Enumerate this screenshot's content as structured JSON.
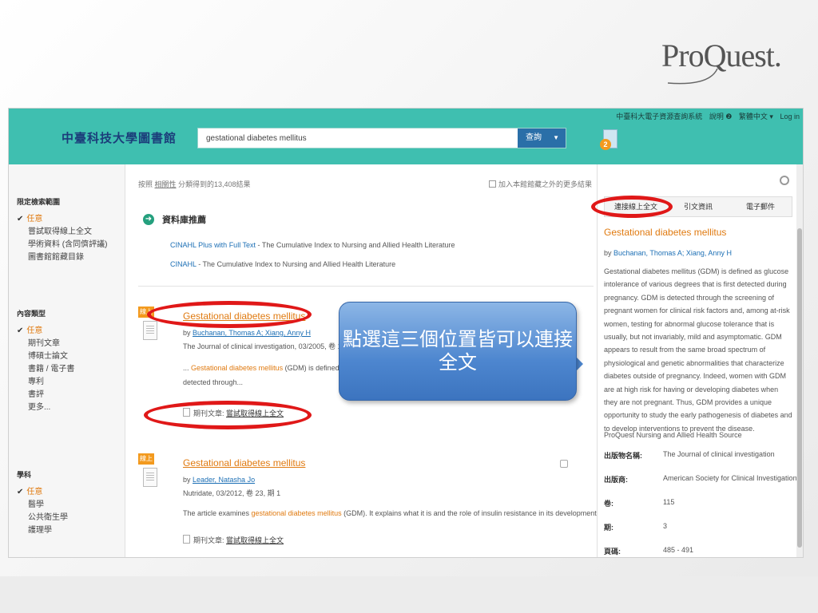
{
  "brand": {
    "logo_text": "ProQuest."
  },
  "header": {
    "top_links": [
      "中臺科大電子資源查詢系統",
      "說明 ❷",
      "繁體中文 ▾",
      "Log in"
    ],
    "library_name": "中臺科技大學圖書館",
    "search": {
      "value": "gestational diabetes mellitus",
      "button_label": "查詢"
    },
    "folder_count": "2"
  },
  "sidebar": {
    "groups": [
      {
        "title": "限定檢索範圍",
        "items": [
          "任意",
          "嘗試取得線上全文",
          "學術資料 (含同儕評議)",
          "圖書館館藏目錄"
        ]
      },
      {
        "title": "內容類型",
        "items": [
          "任意",
          "期刊文章",
          "博碩士論文",
          "書籍 / 電子書",
          "專利",
          "書評",
          "更多..."
        ]
      },
      {
        "title": "學科",
        "items": [
          "任意",
          "醫學",
          "公共衛生學",
          "護理學"
        ]
      }
    ]
  },
  "main": {
    "result_count": {
      "prefix": "按照 ",
      "link": "相關性",
      "suffix": " 分類得到的13,408結果"
    },
    "expand_label": "加入本館館藏之外的更多結果",
    "db_recommend": {
      "title": "資料庫推薦",
      "links": [
        {
          "name": "CINAHL Plus with Full Text",
          "desc": " - The Cumulative Index to Nursing and Allied Health Literature"
        },
        {
          "name": "CINAHL",
          "desc": " - The Cumulative Index to Nursing and Allied Health Literature"
        }
      ]
    },
    "records": [
      {
        "tag": "線上",
        "title": "Gestational diabetes mellitus",
        "by": "by ",
        "authors": "Buchanan, Thomas A; Xiang, Anny H",
        "pub": "The Journal of clinical investigation, 03/2005, 卷 115, 期 3",
        "snippet_pre": "... ",
        "snippet_hl": "Gestational diabetes mellitus",
        "snippet_post": " (GDM) is defined as glucose",
        "snippet_line2": "detected through...",
        "type_label": "期刊文章: ",
        "fulltext_link": "嘗試取得線上全文"
      },
      {
        "tag": "線上",
        "title": "Gestational diabetes mellitus",
        "by": "by ",
        "authors": "Leader, Natasha Jo",
        "pub": "Nutridate, 03/2012, 卷 23, 期 1",
        "snippet_pre": "The article examines ",
        "snippet_hl": "gestational diabetes mellitus",
        "snippet_post": " (GDM). It explains what it is and the role of insulin resistance in its development...",
        "type_label": "期刊文章: ",
        "fulltext_link": "嘗試取得線上全文"
      }
    ]
  },
  "right_panel": {
    "tabs": [
      "連接線上全文",
      "引文資訊",
      "電子郵件"
    ],
    "title": "Gestational diabetes mellitus",
    "by": "by ",
    "authors": "Buchanan, Thomas A; Xiang, Anny H",
    "abstract": "Gestational diabetes mellitus (GDM) is defined as glucose intolerance of various degrees that is first detected during pregnancy. GDM is detected through the screening of pregnant women for clinical risk factors and, among at-risk women, testing for abnormal glucose tolerance that is usually, but not invariably, mild and asymptomatic. GDM appears to result from the same broad spectrum of physiological and genetic abnormalities that characterize diabetes outside of pregnancy. Indeed, women with GDM are at high risk for having or developing diabetes when they are not pregnant. Thus, GDM provides a unique opportunity to study the early pathogenesis of diabetes and to develop interventions to prevent the disease.",
    "source": "ProQuest Nursing and Allied Health Source",
    "meta": [
      {
        "k": "出版物名稱:",
        "v": "The Journal of clinical investigation"
      },
      {
        "k": "出版商:",
        "v": "American Society for Clinical Investigation"
      },
      {
        "k": "卷:",
        "v": "115"
      },
      {
        "k": "期:",
        "v": "3"
      },
      {
        "k": "頁碼:",
        "v": "485 - 491"
      }
    ]
  },
  "annotation": {
    "callout": "點選這三個位置皆可以連接全文",
    "color": "#e01818"
  }
}
